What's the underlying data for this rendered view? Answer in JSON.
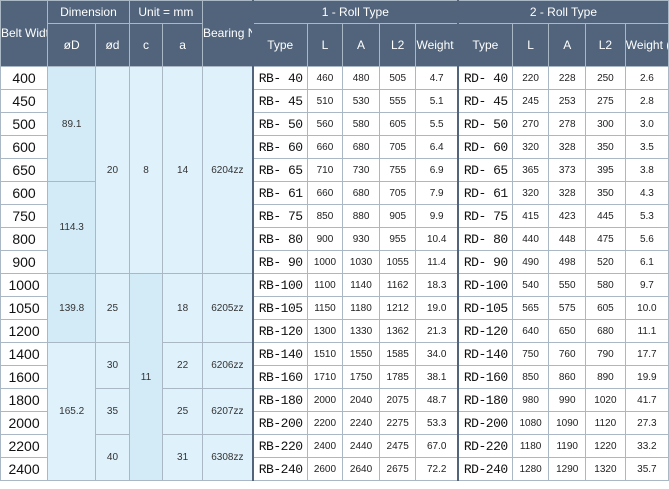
{
  "header": {
    "belt_width": "Belt Width",
    "dimension": "Dimension",
    "unit": "Unit = mm",
    "bearing": "Bearing No.",
    "roll1": "1 - Roll Type",
    "roll2": "2 - Roll Type",
    "oD": "øD",
    "od": "ød",
    "c": "c",
    "a": "a",
    "type": "Type",
    "L": "L",
    "A": "A",
    "L2": "L2",
    "weight": "Weight (kg)"
  },
  "rows": [
    {
      "bw": "400",
      "t1": "RB- 40",
      "L1": "460",
      "A1": "480",
      "L21": "505",
      "W1": "4.7",
      "t2": "RD- 40",
      "L2": "220",
      "A2": "228",
      "L22": "250",
      "W2": "2.6"
    },
    {
      "bw": "450",
      "t1": "RB- 45",
      "L1": "510",
      "A1": "530",
      "L21": "555",
      "W1": "5.1",
      "t2": "RD- 45",
      "L2": "245",
      "A2": "253",
      "L22": "275",
      "W2": "2.8"
    },
    {
      "bw": "500",
      "t1": "RB- 50",
      "L1": "560",
      "A1": "580",
      "L21": "605",
      "W1": "5.5",
      "t2": "RD- 50",
      "L2": "270",
      "A2": "278",
      "L22": "300",
      "W2": "3.0"
    },
    {
      "bw": "600",
      "t1": "RB- 60",
      "L1": "660",
      "A1": "680",
      "L21": "705",
      "W1": "6.4",
      "t2": "RD- 60",
      "L2": "320",
      "A2": "328",
      "L22": "350",
      "W2": "3.5"
    },
    {
      "bw": "650",
      "t1": "RB- 65",
      "L1": "710",
      "A1": "730",
      "L21": "755",
      "W1": "6.9",
      "t2": "RD- 65",
      "L2": "365",
      "A2": "373",
      "L22": "395",
      "W2": "3.8"
    },
    {
      "bw": "600",
      "t1": "RB- 61",
      "L1": "660",
      "A1": "680",
      "L21": "705",
      "W1": "7.9",
      "t2": "RD- 61",
      "L2": "320",
      "A2": "328",
      "L22": "350",
      "W2": "4.3"
    },
    {
      "bw": "750",
      "t1": "RB- 75",
      "L1": "850",
      "A1": "880",
      "L21": "905",
      "W1": "9.9",
      "t2": "RD- 75",
      "L2": "415",
      "A2": "423",
      "L22": "445",
      "W2": "5.3"
    },
    {
      "bw": "800",
      "t1": "RB- 80",
      "L1": "900",
      "A1": "930",
      "L21": "955",
      "W1": "10.4",
      "t2": "RD- 80",
      "L2": "440",
      "A2": "448",
      "L22": "475",
      "W2": "5.6"
    },
    {
      "bw": "900",
      "t1": "RB- 90",
      "L1": "1000",
      "A1": "1030",
      "L21": "1055",
      "W1": "11.4",
      "t2": "RD- 90",
      "L2": "490",
      "A2": "498",
      "L22": "520",
      "W2": "6.1"
    },
    {
      "bw": "1000",
      "t1": "RB-100",
      "L1": "1100",
      "A1": "1140",
      "L21": "1162",
      "W1": "18.3",
      "t2": "RD-100",
      "L2": "540",
      "A2": "550",
      "L22": "580",
      "W2": "9.7"
    },
    {
      "bw": "1050",
      "t1": "RB-105",
      "L1": "1150",
      "A1": "1180",
      "L21": "1212",
      "W1": "19.0",
      "t2": "RD-105",
      "L2": "565",
      "A2": "575",
      "L22": "605",
      "W2": "10.0"
    },
    {
      "bw": "1200",
      "t1": "RB-120",
      "L1": "1300",
      "A1": "1330",
      "L21": "1362",
      "W1": "21.3",
      "t2": "RD-120",
      "L2": "640",
      "A2": "650",
      "L22": "680",
      "W2": "11.1"
    },
    {
      "bw": "1400",
      "t1": "RB-140",
      "L1": "1510",
      "A1": "1550",
      "L21": "1585",
      "W1": "34.0",
      "t2": "RD-140",
      "L2": "750",
      "A2": "760",
      "L22": "790",
      "W2": "17.7"
    },
    {
      "bw": "1600",
      "t1": "RB-160",
      "L1": "1710",
      "A1": "1750",
      "L21": "1785",
      "W1": "38.1",
      "t2": "RD-160",
      "L2": "850",
      "A2": "860",
      "L22": "890",
      "W2": "19.9"
    },
    {
      "bw": "1800",
      "t1": "RB-180",
      "L1": "2000",
      "A1": "2040",
      "L21": "2075",
      "W1": "48.7",
      "t2": "RD-180",
      "L2": "980",
      "A2": "990",
      "L22": "1020",
      "W2": "41.7"
    },
    {
      "bw": "2000",
      "t1": "RB-200",
      "L1": "2200",
      "A1": "2240",
      "L21": "2275",
      "W1": "53.3",
      "t2": "RD-200",
      "L2": "1080",
      "A2": "1090",
      "L22": "1120",
      "W2": "27.3"
    },
    {
      "bw": "2200",
      "t1": "RB-220",
      "L1": "2400",
      "A1": "2440",
      "L21": "2475",
      "W1": "67.0",
      "t2": "RD-220",
      "L2": "1180",
      "A2": "1190",
      "L22": "1220",
      "W2": "33.2"
    },
    {
      "bw": "2400",
      "t1": "RB-240",
      "L1": "2600",
      "A1": "2640",
      "L21": "2675",
      "W1": "72.2",
      "t2": "RD-240",
      "L2": "1280",
      "A2": "1290",
      "L22": "1320",
      "W2": "35.7"
    }
  ],
  "merged": {
    "oD_1": "89.1",
    "oD_2": "114.3",
    "oD_3": "139.8",
    "oD_4": "165.2",
    "od_1": "20",
    "od_2": "25",
    "od_3": "30",
    "od_4": "35",
    "od_5": "40",
    "c_1": "8",
    "c_2": "11",
    "a_1": "14",
    "a_2": "18",
    "a_3": "22",
    "a_4": "25",
    "a_5": "31",
    "brg_1": "6204zz",
    "brg_2": "6205zz",
    "brg_3": "6206zz",
    "brg_4": "6207zz",
    "brg_5": "6308zz"
  }
}
